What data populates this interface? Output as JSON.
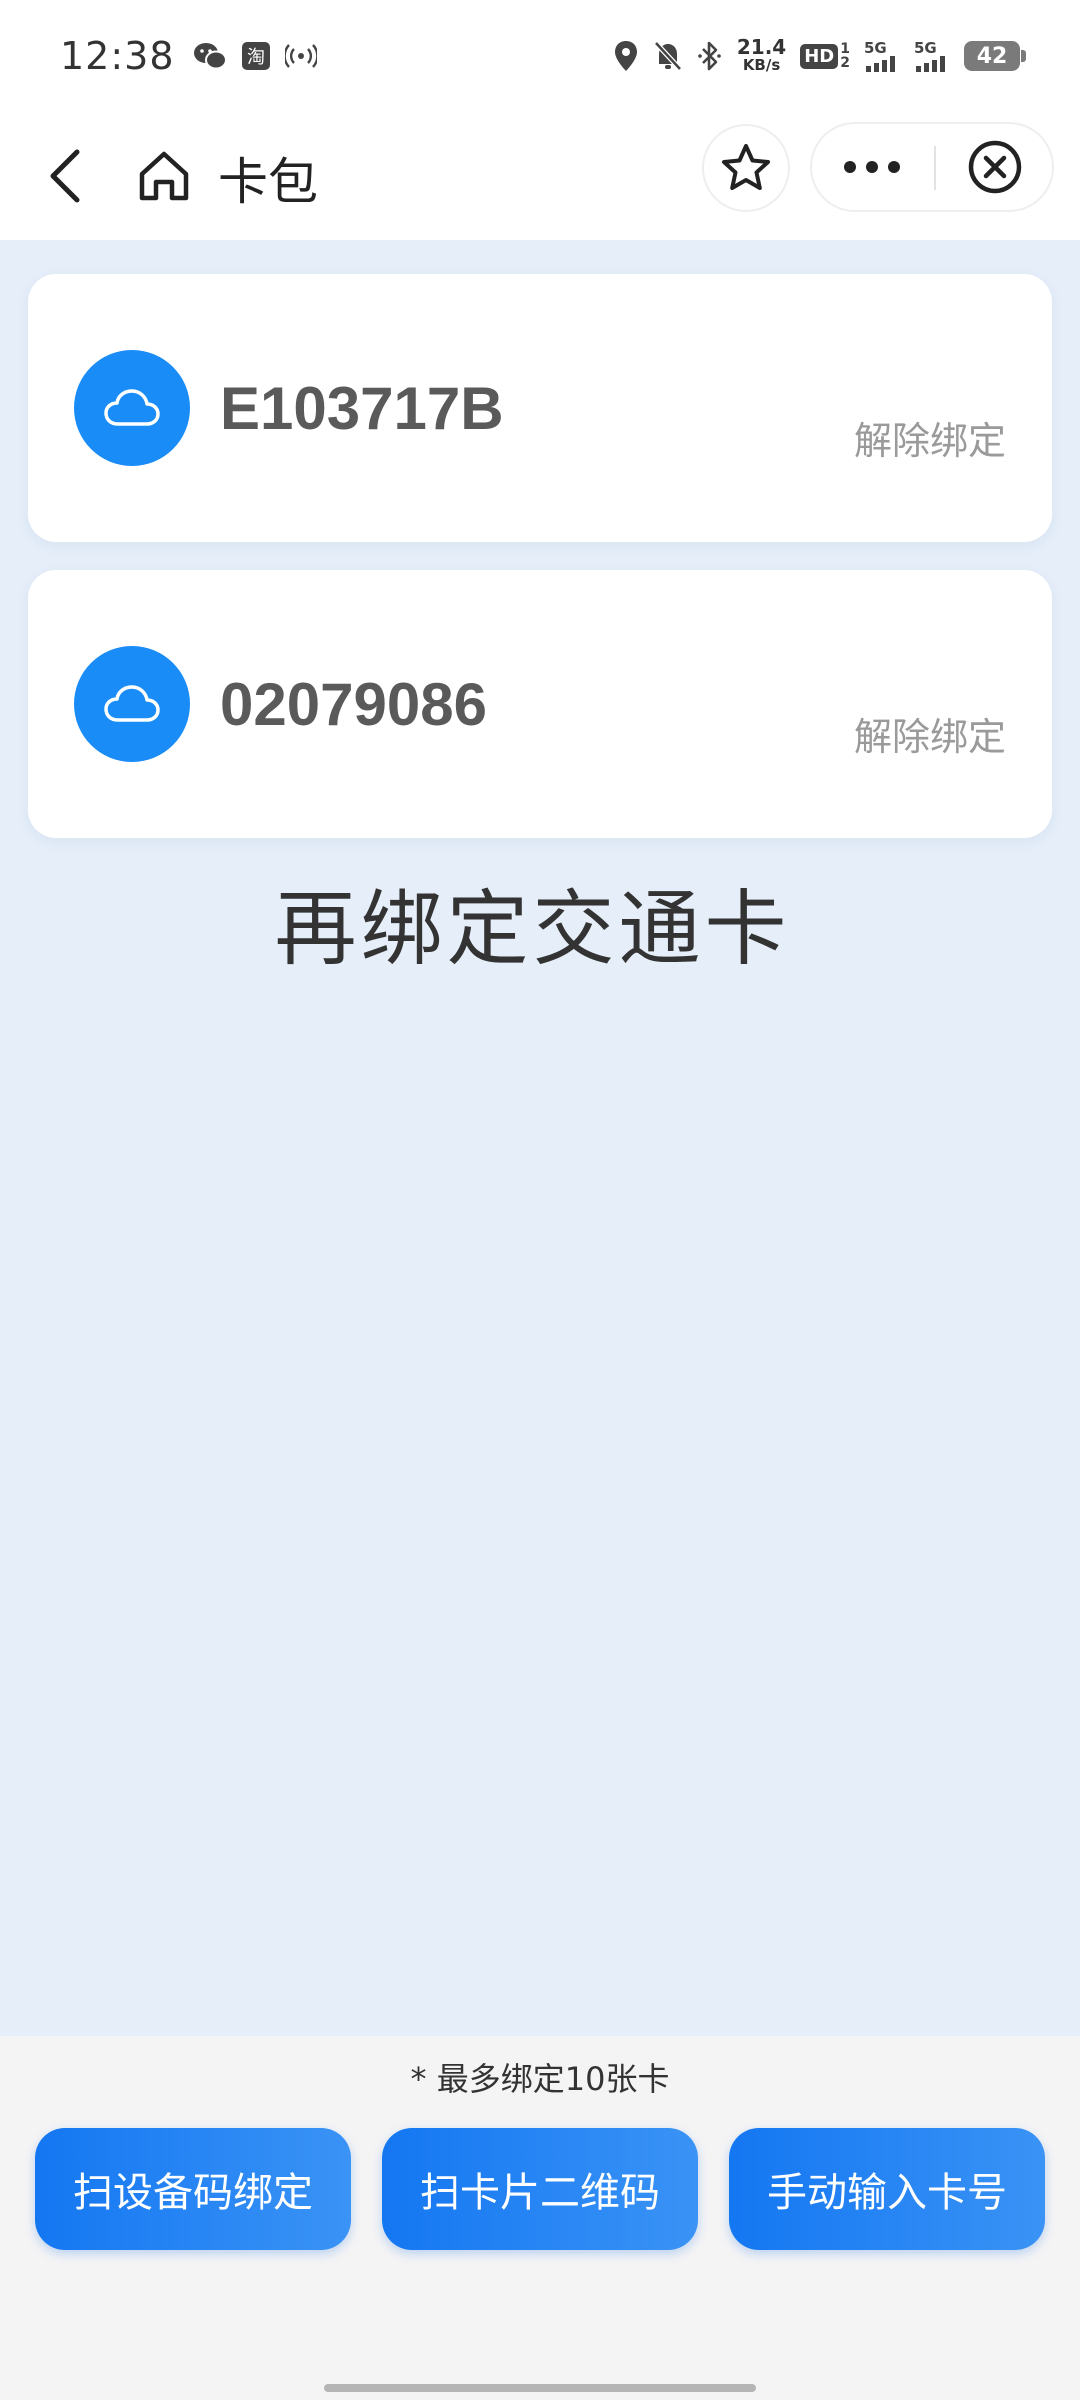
{
  "status_bar": {
    "time": "12:38",
    "left_icons": [
      "wechat-icon",
      "taobao-icon",
      "hotspot-icon"
    ],
    "net_speed_value": "21.4",
    "net_speed_unit": "KB/s",
    "hd_label": "HD",
    "signal1_label": "5G",
    "signal2_label": "5G",
    "battery": "42"
  },
  "nav": {
    "title": "卡包"
  },
  "cards": [
    {
      "number": "E103717B",
      "action": "解除绑定"
    },
    {
      "number": "02079086",
      "action": "解除绑定"
    }
  ],
  "rebind_title": "再绑定交通卡",
  "bottom": {
    "hint": "* 最多绑定10张卡",
    "buttons": [
      "扫设备码绑定",
      "扫卡片二维码",
      "手动输入卡号"
    ]
  },
  "colors": {
    "accent": "#1a8cf7",
    "page_bg": "#e5eef9",
    "button_start": "#1477f2",
    "button_end": "#3a93f5"
  }
}
